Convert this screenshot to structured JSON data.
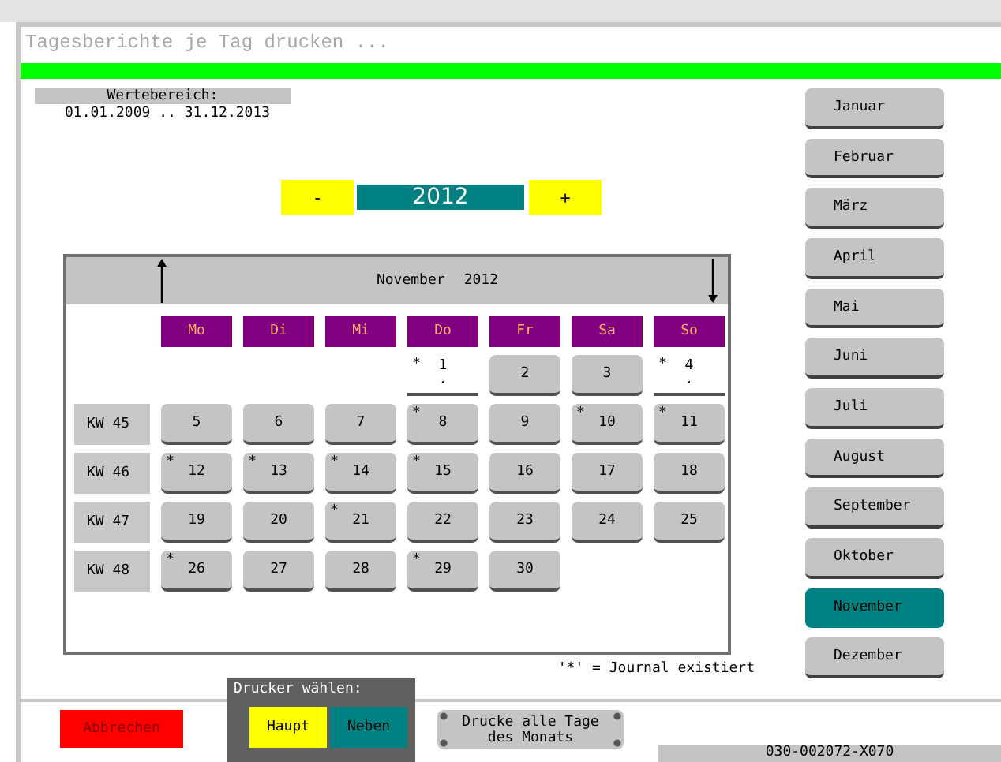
{
  "window": {
    "title": "Tagesberichte je Tag drucken ..."
  },
  "range": {
    "label": "Wertebereich:",
    "value": "01.01.2009 .. 31.12.2013"
  },
  "year": {
    "decrement": "-",
    "value": "2012",
    "increment": "+"
  },
  "calendar": {
    "month": "November",
    "year": "2012",
    "weekdays": [
      "Mo",
      "Di",
      "Mi",
      "Do",
      "Fr",
      "Sa",
      "So"
    ],
    "weeks": [
      {
        "days": [
          {
            "kind": "empty"
          },
          {
            "kind": "empty"
          },
          {
            "kind": "empty"
          },
          {
            "day": "1",
            "marker": "*",
            "note": ".",
            "kind": "plain"
          },
          {
            "day": "2",
            "kind": "button"
          },
          {
            "day": "3",
            "kind": "button"
          },
          {
            "day": "4",
            "marker": "*",
            "note": ".",
            "kind": "plain"
          }
        ]
      },
      {
        "label": "KW 45",
        "days": [
          {
            "day": "5",
            "kind": "button"
          },
          {
            "day": "6",
            "kind": "button"
          },
          {
            "day": "7",
            "kind": "button"
          },
          {
            "day": "8",
            "marker": "*",
            "kind": "button"
          },
          {
            "day": "9",
            "kind": "button"
          },
          {
            "day": "10",
            "marker": "*",
            "kind": "button"
          },
          {
            "day": "11",
            "marker": "*",
            "kind": "button"
          }
        ]
      },
      {
        "label": "KW 46",
        "days": [
          {
            "day": "12",
            "marker": "*",
            "kind": "button"
          },
          {
            "day": "13",
            "marker": "*",
            "kind": "button"
          },
          {
            "day": "14",
            "marker": "*",
            "kind": "button"
          },
          {
            "day": "15",
            "marker": "*",
            "kind": "button"
          },
          {
            "day": "16",
            "kind": "button"
          },
          {
            "day": "17",
            "kind": "button"
          },
          {
            "day": "18",
            "kind": "button"
          }
        ]
      },
      {
        "label": "KW 47",
        "days": [
          {
            "day": "19",
            "kind": "button"
          },
          {
            "day": "20",
            "kind": "button"
          },
          {
            "day": "21",
            "marker": "*",
            "kind": "button"
          },
          {
            "day": "22",
            "kind": "button"
          },
          {
            "day": "23",
            "kind": "button"
          },
          {
            "day": "24",
            "kind": "button"
          },
          {
            "day": "25",
            "kind": "button"
          }
        ]
      },
      {
        "label": "KW 48",
        "days": [
          {
            "day": "26",
            "marker": "*",
            "kind": "button"
          },
          {
            "day": "27",
            "kind": "button"
          },
          {
            "day": "28",
            "kind": "button"
          },
          {
            "day": "29",
            "marker": "*",
            "kind": "button"
          },
          {
            "day": "30",
            "kind": "button"
          },
          {
            "kind": "empty"
          },
          {
            "kind": "empty"
          }
        ]
      }
    ]
  },
  "legend": "'*' = Journal existiert",
  "months": [
    {
      "label": "Januar",
      "selected": false
    },
    {
      "label": "Februar",
      "selected": false
    },
    {
      "label": "März",
      "selected": false
    },
    {
      "label": "April",
      "selected": false
    },
    {
      "label": "Mai",
      "selected": false
    },
    {
      "label": "Juni",
      "selected": false
    },
    {
      "label": "Juli",
      "selected": false
    },
    {
      "label": "August",
      "selected": false
    },
    {
      "label": "September",
      "selected": false
    },
    {
      "label": "Oktober",
      "selected": false
    },
    {
      "label": "November",
      "selected": true
    },
    {
      "label": "Dezember",
      "selected": false
    }
  ],
  "cancel_button": "Abbrechen",
  "printer": {
    "label": "Drucker wählen:",
    "options": [
      {
        "label": "Haupt",
        "color": "#ffff00"
      },
      {
        "label": "Neben",
        "color": "#008080"
      }
    ]
  },
  "print_all_button": "Drucke alle Tage des Monats",
  "status_code": "030-002072-X070"
}
